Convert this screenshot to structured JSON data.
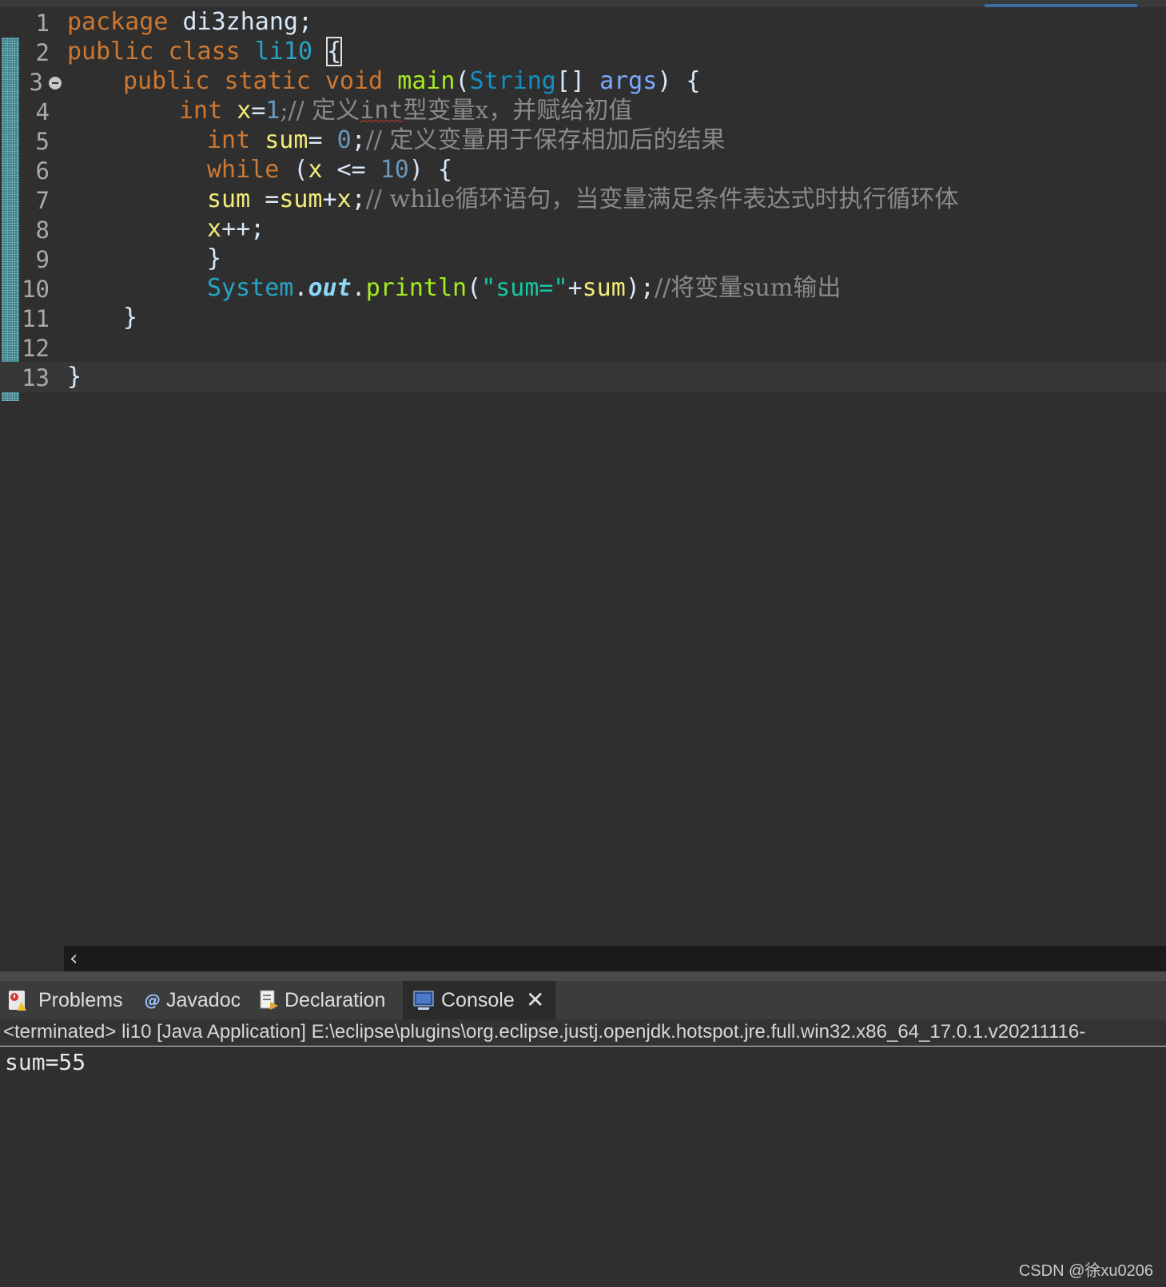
{
  "editor": {
    "lines": [
      {
        "n": "1",
        "tokens": [
          "package",
          " di3zhang;"
        ]
      },
      {
        "n": "2",
        "tokens": [
          "public",
          " ",
          "class",
          " ",
          "li10",
          " ",
          "{"
        ]
      },
      {
        "n": "3",
        "tokens": [
          "public",
          " ",
          "static",
          " ",
          "void",
          " ",
          "main",
          "(",
          "String",
          "[] ",
          "args",
          ") {"
        ]
      },
      {
        "n": "4",
        "tokens": [
          "int",
          " ",
          "x",
          "=",
          "1",
          ";// 定义",
          "int",
          "型变量x，并赋给初值"
        ]
      },
      {
        "n": "5",
        "tokens": [
          "int",
          " ",
          "sum",
          "= ",
          "0",
          ";",
          "// 定义变量用于保存相加后的结果"
        ]
      },
      {
        "n": "6",
        "tokens": [
          "while",
          " (",
          "x",
          " <= ",
          "10",
          ") {"
        ]
      },
      {
        "n": "7",
        "tokens": [
          "sum",
          " =",
          "sum",
          "+",
          "x",
          ";",
          "// while循环语句，当变量满足条件表达式时执行循环体"
        ]
      },
      {
        "n": "8",
        "tokens": [
          "x",
          "++;"
        ]
      },
      {
        "n": "9",
        "tokens": [
          "}"
        ]
      },
      {
        "n": "10",
        "tokens": [
          "System",
          ".",
          "out",
          ".",
          "println",
          "(",
          "\"sum=\"",
          "+",
          "sum",
          ");",
          "//将变量sum输出"
        ]
      },
      {
        "n": "11",
        "tokens": [
          "}"
        ]
      },
      {
        "n": "12",
        "tokens": []
      },
      {
        "n": "13",
        "tokens": [
          "}"
        ]
      }
    ]
  },
  "scrollbar": {
    "left_arrow": "‹"
  },
  "bottom_panel": {
    "tabs": [
      {
        "label": "Problems",
        "icon": "problems-icon"
      },
      {
        "label": "Javadoc",
        "icon": "javadoc-icon"
      },
      {
        "label": "Declaration",
        "icon": "declaration-icon"
      },
      {
        "label": "Console",
        "icon": "console-icon",
        "active": true
      }
    ],
    "close_glyph": "✕",
    "console_header": "<terminated> li10 [Java Application] E:\\eclipse\\plugins\\org.eclipse.justj.openjdk.hotspot.jre.full.win32.x86_64_17.0.1.v20211116-",
    "console_output": "sum=55"
  },
  "watermark": "CSDN @徐xu0206",
  "colors": {
    "background": "#2f2f2f",
    "keyword": "#cc7832",
    "variable": "#f3ec79",
    "method": "#a7ec21",
    "string": "#17c6a3",
    "comment": "#8a8a8a",
    "number": "#6897bb",
    "type": "#1290c3"
  }
}
